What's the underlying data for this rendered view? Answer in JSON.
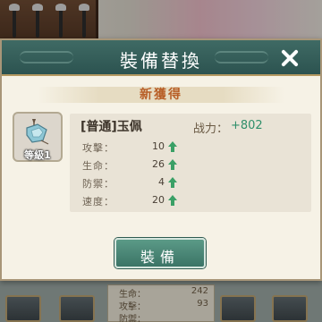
{
  "dialog": {
    "title": "裝備替換",
    "banner": "新獲得",
    "equip_label": "裝備"
  },
  "item": {
    "level_badge": "等級1",
    "name": "[普通]玉佩",
    "power_label": "战力：",
    "power_value": "+802",
    "stats": [
      {
        "label": "攻擊：",
        "value": "10"
      },
      {
        "label": "生命：",
        "value": "26"
      },
      {
        "label": "防禦：",
        "value": "4"
      },
      {
        "label": "速度：",
        "value": "20"
      }
    ]
  },
  "background": {
    "stats": [
      {
        "label": "生命：",
        "value": "242"
      },
      {
        "label": "攻擊：",
        "value": "93"
      },
      {
        "label": "防禦：",
        "value": ""
      }
    ]
  },
  "colors": {
    "header": "#2c5350",
    "accent_green": "#3aa066",
    "banner_text": "#b85f27"
  }
}
